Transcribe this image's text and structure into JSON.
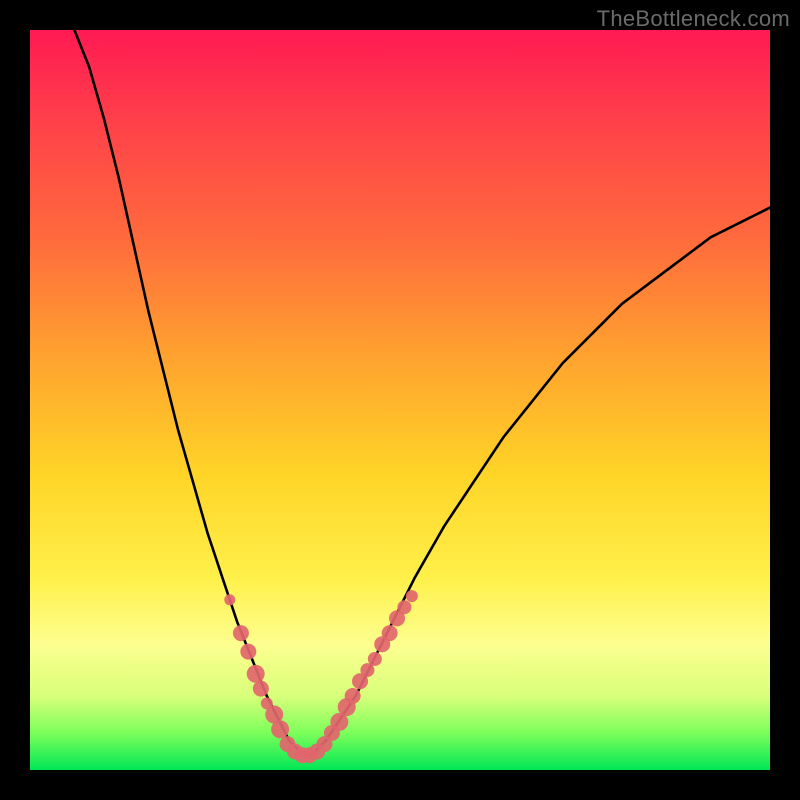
{
  "watermark": "TheBottleneck.com",
  "palette": {
    "gradient_top": "#ff1a53",
    "gradient_mid1": "#ffa52e",
    "gradient_mid2": "#fff04a",
    "gradient_bottom": "#00e756",
    "curve": "#000000",
    "markers": "#e2666d",
    "background": "#000000"
  },
  "chart_data": {
    "type": "line",
    "title": "",
    "xlabel": "",
    "ylabel": "",
    "xlim": [
      0,
      100
    ],
    "ylim": [
      0,
      100
    ],
    "grid": false,
    "legend": false,
    "series": [
      {
        "name": "bottleneck-curve",
        "x": [
          6,
          8,
          10,
          12,
          14,
          16,
          18,
          20,
          22,
          24,
          26,
          28,
          30,
          32,
          33,
          34,
          35,
          36,
          37,
          38,
          39,
          40,
          42,
          44,
          46,
          48,
          50,
          52,
          56,
          60,
          64,
          68,
          72,
          76,
          80,
          84,
          88,
          92,
          96,
          100
        ],
        "y": [
          100,
          95,
          88,
          80,
          71,
          62,
          54,
          46,
          39,
          32,
          26,
          20,
          15,
          10,
          8,
          6,
          4,
          3,
          2,
          2,
          3,
          4,
          7,
          10,
          14,
          18,
          22,
          26,
          33,
          39,
          45,
          50,
          55,
          59,
          63,
          66,
          69,
          72,
          74,
          76
        ]
      }
    ],
    "marker_clusters": [
      {
        "name": "left-markers",
        "points": [
          {
            "x": 27.0,
            "y": 23.0,
            "r": 1.1
          },
          {
            "x": 28.5,
            "y": 18.5,
            "r": 1.6
          },
          {
            "x": 29.5,
            "y": 16.0,
            "r": 1.6
          },
          {
            "x": 30.5,
            "y": 13.0,
            "r": 1.8
          },
          {
            "x": 31.2,
            "y": 11.0,
            "r": 1.6
          },
          {
            "x": 32.0,
            "y": 9.0,
            "r": 1.2
          },
          {
            "x": 33.0,
            "y": 7.5,
            "r": 1.8
          },
          {
            "x": 33.8,
            "y": 5.5,
            "r": 1.8
          }
        ]
      },
      {
        "name": "bottom-markers",
        "points": [
          {
            "x": 34.8,
            "y": 3.5,
            "r": 1.6
          },
          {
            "x": 35.8,
            "y": 2.5,
            "r": 1.6
          },
          {
            "x": 36.8,
            "y": 2.0,
            "r": 1.6
          },
          {
            "x": 37.8,
            "y": 2.0,
            "r": 1.6
          },
          {
            "x": 38.8,
            "y": 2.5,
            "r": 1.6
          },
          {
            "x": 39.8,
            "y": 3.5,
            "r": 1.6
          }
        ]
      },
      {
        "name": "right-markers",
        "points": [
          {
            "x": 40.8,
            "y": 5.0,
            "r": 1.6
          },
          {
            "x": 41.8,
            "y": 6.5,
            "r": 1.8
          },
          {
            "x": 42.8,
            "y": 8.5,
            "r": 1.8
          },
          {
            "x": 43.6,
            "y": 10.0,
            "r": 1.6
          },
          {
            "x": 44.6,
            "y": 12.0,
            "r": 1.6
          },
          {
            "x": 45.6,
            "y": 13.5,
            "r": 1.4
          },
          {
            "x": 46.6,
            "y": 15.0,
            "r": 1.4
          },
          {
            "x": 47.6,
            "y": 17.0,
            "r": 1.6
          },
          {
            "x": 48.6,
            "y": 18.5,
            "r": 1.6
          },
          {
            "x": 49.6,
            "y": 20.5,
            "r": 1.6
          },
          {
            "x": 50.6,
            "y": 22.0,
            "r": 1.4
          },
          {
            "x": 51.6,
            "y": 23.5,
            "r": 1.2
          }
        ]
      }
    ]
  }
}
